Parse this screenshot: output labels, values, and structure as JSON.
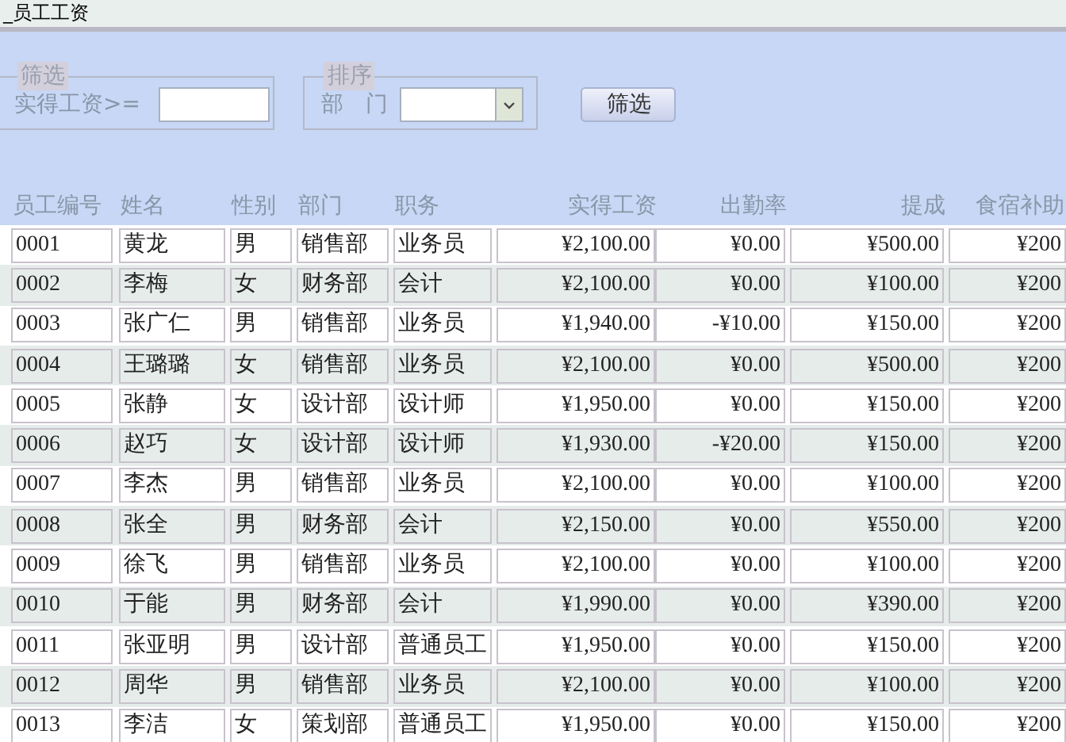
{
  "window": {
    "title": "_员工工资"
  },
  "filter_group": {
    "legend": "筛选",
    "label": "实得工资>="
  },
  "sort_group": {
    "legend": "排序",
    "label": "部　门"
  },
  "filter_button": "筛选",
  "table": {
    "columns": [
      "员工编号",
      "姓名",
      "性别",
      "部门",
      "职务",
      "实得工资",
      "出勤率",
      "提成",
      "食宿补助"
    ],
    "rows": [
      [
        "0001",
        "黄龙",
        "男",
        "销售部",
        "业务员",
        "¥2,100.00",
        "¥0.00",
        "¥500.00",
        "¥200"
      ],
      [
        "0002",
        "李梅",
        "女",
        "财务部",
        "会计",
        "¥2,100.00",
        "¥0.00",
        "¥100.00",
        "¥200"
      ],
      [
        "0003",
        "张广仁",
        "男",
        "销售部",
        "业务员",
        "¥1,940.00",
        "-¥10.00",
        "¥150.00",
        "¥200"
      ],
      [
        "0004",
        "王璐璐",
        "女",
        "销售部",
        "业务员",
        "¥2,100.00",
        "¥0.00",
        "¥500.00",
        "¥200"
      ],
      [
        "0005",
        "张静",
        "女",
        "设计部",
        "设计师",
        "¥1,950.00",
        "¥0.00",
        "¥150.00",
        "¥200"
      ],
      [
        "0006",
        "赵巧",
        "女",
        "设计部",
        "设计师",
        "¥1,930.00",
        "-¥20.00",
        "¥150.00",
        "¥200"
      ],
      [
        "0007",
        "李杰",
        "男",
        "销售部",
        "业务员",
        "¥2,100.00",
        "¥0.00",
        "¥100.00",
        "¥200"
      ],
      [
        "0008",
        "张全",
        "男",
        "财务部",
        "会计",
        "¥2,150.00",
        "¥0.00",
        "¥550.00",
        "¥200"
      ],
      [
        "0009",
        "徐飞",
        "男",
        "销售部",
        "业务员",
        "¥2,100.00",
        "¥0.00",
        "¥100.00",
        "¥200"
      ],
      [
        "0010",
        "于能",
        "男",
        "财务部",
        "会计",
        "¥1,990.00",
        "¥0.00",
        "¥390.00",
        "¥200"
      ],
      [
        "0011",
        "张亚明",
        "男",
        "设计部",
        "普通员工",
        "¥1,950.00",
        "¥0.00",
        "¥150.00",
        "¥200"
      ],
      [
        "0012",
        "周华",
        "男",
        "销售部",
        "业务员",
        "¥2,100.00",
        "¥0.00",
        "¥100.00",
        "¥200"
      ],
      [
        "0013",
        "李洁",
        "女",
        "策划部",
        "普通员工",
        "¥1,950.00",
        "¥0.00",
        "¥150.00",
        "¥200"
      ]
    ]
  }
}
